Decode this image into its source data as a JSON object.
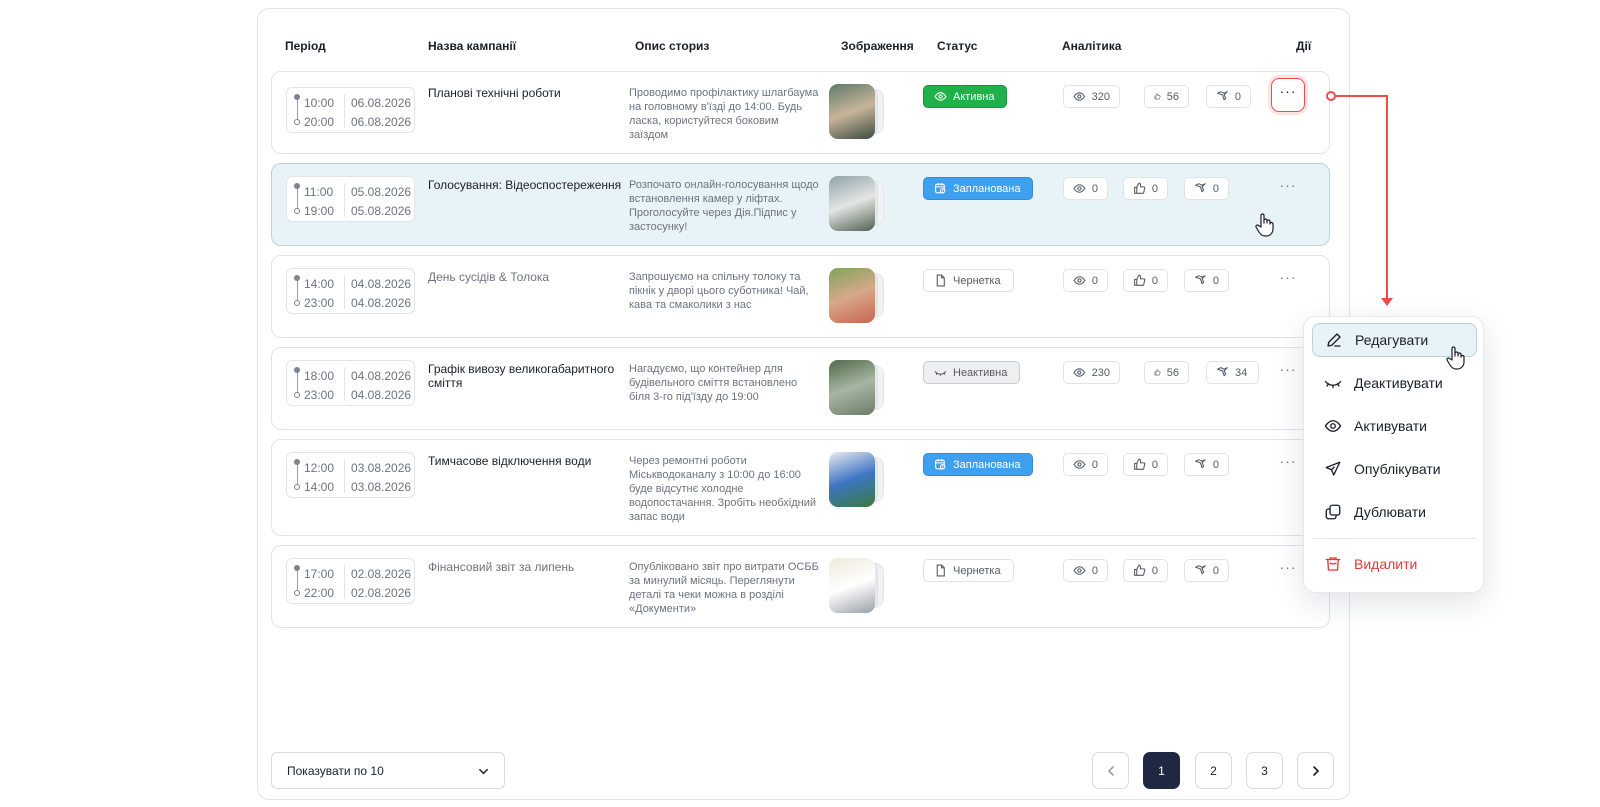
{
  "headers": {
    "period": "Період",
    "name": "Назва кампанії",
    "description": "Опис сториз",
    "image": "Зображення",
    "status": "Статус",
    "analytics": "Аналітика",
    "actions": "Дії"
  },
  "rows": [
    {
      "time_start": "10:00",
      "date_start": "06.08.2026",
      "time_end": "20:00",
      "date_end": "06.08.2026",
      "name": "Планові технічні роботи",
      "description": "Проводимо профілактику шлагбаума на головному в'їзді до 14:00. Будь ласка, користуйтеся боковим заїздом",
      "status": "Активна",
      "views": "320",
      "likes": "56",
      "shares": "0"
    },
    {
      "time_start": "11:00",
      "date_start": "05.08.2026",
      "time_end": "19:00",
      "date_end": "05.08.2026",
      "name": "Голосування: Відеоспостереження",
      "description": "Розпочато онлайн-голосування щодо встановлення камер у ліфтах. Проголосуйте через Дія.Підпис у застосунку!",
      "status": "Запланована",
      "views": "0",
      "likes": "0",
      "shares": "0"
    },
    {
      "time_start": "14:00",
      "date_start": "04.08.2026",
      "time_end": "23:00",
      "date_end": "04.08.2026",
      "name": "День сусідів & Толока",
      "description": "Запрошуємо на спільну толоку та пікнік у дворі цього суботника! Чай, кава та смаколики з нас",
      "status": "Чернетка",
      "views": "0",
      "likes": "0",
      "shares": "0"
    },
    {
      "time_start": "18:00",
      "date_start": "04.08.2026",
      "time_end": "23:00",
      "date_end": "04.08.2026",
      "name": "Графік вивозу великогабаритного сміття",
      "description": "Нагадуємо, що контейнер для будівельного сміття встановлено біля 3-го під'їзду до 19:00",
      "status": "Неактивна",
      "views": "230",
      "likes": "56",
      "shares": "34"
    },
    {
      "time_start": "12:00",
      "date_start": "03.08.2026",
      "time_end": "14:00",
      "date_end": "03.08.2026",
      "name": "Тимчасове відключення води",
      "description": "Через ремонтні роботи Міськводоканалу з 10:00 до 16:00 буде відсутнє холодне водопостачання. Зробіть необхідний запас води",
      "status": "Запланована",
      "views": "0",
      "likes": "0",
      "shares": "0"
    },
    {
      "time_start": "17:00",
      "date_start": "02.08.2026",
      "time_end": "22:00",
      "date_end": "02.08.2026",
      "name": "Фінансовий звіт за липень",
      "description": "Опубліковано звіт про витрати ОСББ за минулий місяць. Переглянути деталі та чеки можна в розділі «Документи»",
      "status": "Чернетка",
      "views": "0",
      "likes": "0",
      "shares": "0"
    }
  ],
  "actions_label": "···",
  "menu": {
    "edit": "Редагувати",
    "deactivate": "Деактивувати",
    "activate": "Активувати",
    "publish": "Опублікувати",
    "duplicate": "Дублювати",
    "delete": "Видалити"
  },
  "footer": {
    "page_size": "Показувати по 10",
    "pages": [
      "1",
      "2",
      "3"
    ],
    "current_page": "1"
  },
  "colors": {
    "active": "#1fb14a",
    "planned": "#3ea0ee",
    "accent_red": "#ef4b4b",
    "pagination_current": "#1f2743"
  }
}
